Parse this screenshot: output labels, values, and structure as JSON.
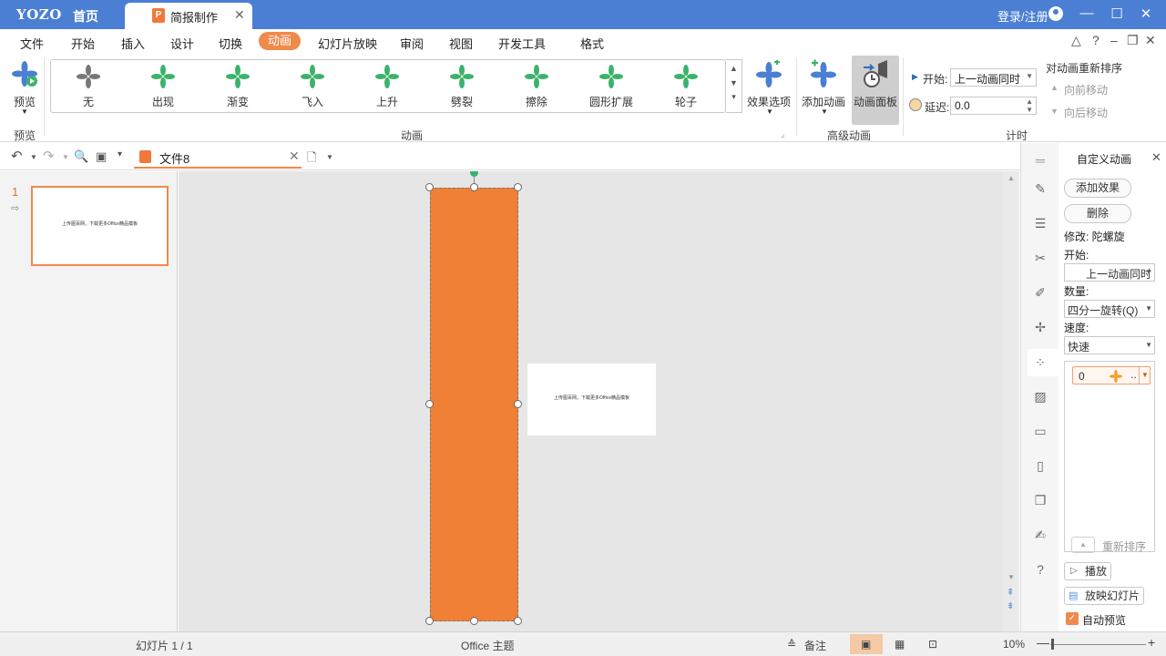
{
  "titlebar": {
    "logo": "YOZO",
    "home": "首页",
    "doc_tab": "简报制作",
    "doc_icon": "P",
    "login": "登录/注册",
    "bg": "#4a7fd4"
  },
  "menu": {
    "items": [
      "文件",
      "开始",
      "插入",
      "设计",
      "切换",
      "动画",
      "幻灯片放映",
      "审阅",
      "视图",
      "开发工具",
      "格式"
    ],
    "active_index": 5,
    "accent": "#f08a4b"
  },
  "ribbon": {
    "preview_label": "预览",
    "preview_group": "预览",
    "gallery": [
      {
        "label": "无",
        "color": "#777777"
      },
      {
        "label": "出现",
        "color": "#3bb36a"
      },
      {
        "label": "渐变",
        "color": "#3bb36a"
      },
      {
        "label": "飞入",
        "color": "#3bb36a"
      },
      {
        "label": "上升",
        "color": "#3bb36a"
      },
      {
        "label": "劈裂",
        "color": "#3bb36a"
      },
      {
        "label": "擦除",
        "color": "#3bb36a"
      },
      {
        "label": "圆形扩展",
        "color": "#3bb36a"
      },
      {
        "label": "轮子",
        "color": "#3bb36a"
      }
    ],
    "effect_options": "效果选项",
    "anim_group": "动画",
    "add_anim": "添加动画",
    "anim_panel": "动画面板",
    "adv_group": "高级动画",
    "start_label": "开始:",
    "start_value": "上一动画同时",
    "delay_label": "延迟:",
    "delay_value": "0.0",
    "reorder_title": "对动画重新排序",
    "move_earlier": "向前移动",
    "move_later": "向后移动",
    "timing_group": "计时"
  },
  "toolbar": {
    "file_name": "文件8"
  },
  "thumbs": {
    "number": "1",
    "text": "上传图百网，下载更多Office精品模板"
  },
  "canvas": {
    "slide_text": "上传图百网，下载更多Office精品模板",
    "shape_color": "#f08035"
  },
  "anim_panel": {
    "title": "自定义动画",
    "add_effect": "添加效果",
    "delete": "删除",
    "modify": "修改: 陀螺旋",
    "start_label": "开始:",
    "start_value": "上一动画同时",
    "amount_label": "数量:",
    "amount_value": "四分一旋转(Q)",
    "speed_label": "速度:",
    "speed_value": "快速",
    "list_item_index": "0",
    "list_item_more": "..",
    "reorder": "重新排序",
    "play": "播放",
    "slideshow": "放映幻灯片",
    "auto_preview": "自动预览"
  },
  "status": {
    "slide": "幻灯片 1 / 1",
    "theme": "Office 主题",
    "notes": "备注",
    "zoom": "10%"
  }
}
